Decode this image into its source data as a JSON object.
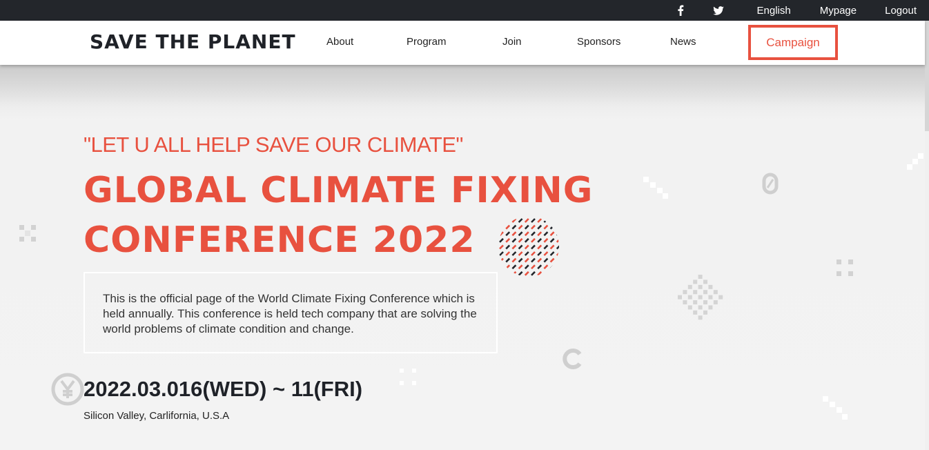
{
  "topbar": {
    "facebook_icon": "facebook-icon",
    "twitter_icon": "twitter-icon",
    "language": "English",
    "mypage": "Mypage",
    "logout": "Logout"
  },
  "header": {
    "logo": "SAVE THE PLANET",
    "nav": [
      "About",
      "Program",
      "Join",
      "Sponsors",
      "News"
    ],
    "campaign": "Campaign"
  },
  "hero": {
    "tagline": "\"LET U ALL HELP SAVE OUR CLIMATE\"",
    "title_line1": "GLOBAL CLIMATE FIXING",
    "title_line2": "CONFERENCE 2022",
    "description": "This is the official page of the World Climate Fixing Conference which is held annually. This conference is held tech company that are solving the world problems of climate condition and change.",
    "date": "2022.03.016(WED) ~ 11(FRI)",
    "location": "Silicon Valley, Carlifornia, U.S.A"
  },
  "colors": {
    "accent": "#e8513f",
    "dark": "#23262b",
    "background": "#f0f0f0"
  }
}
